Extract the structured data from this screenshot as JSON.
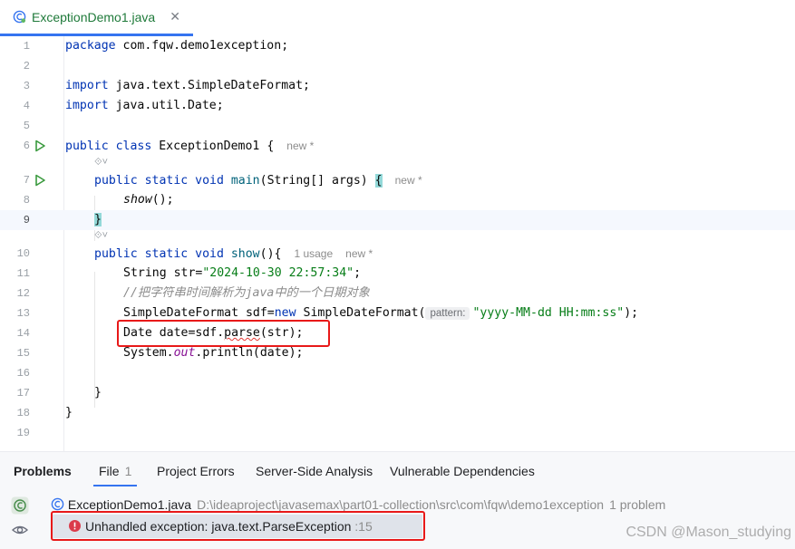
{
  "tab": {
    "title": "ExceptionDemo1.java",
    "close": "✕"
  },
  "editor": {
    "lines": [
      {
        "n": "1"
      },
      {
        "n": "2"
      },
      {
        "n": "3"
      },
      {
        "n": "4"
      },
      {
        "n": "5"
      },
      {
        "n": "6"
      },
      {
        "n": "7"
      },
      {
        "n": "8"
      },
      {
        "n": "9"
      },
      {
        "n": "10"
      },
      {
        "n": "11"
      },
      {
        "n": "12"
      },
      {
        "n": "13"
      },
      {
        "n": "14"
      },
      {
        "n": "15"
      },
      {
        "n": "16"
      },
      {
        "n": "17"
      },
      {
        "n": "18"
      },
      {
        "n": "19"
      }
    ],
    "code": {
      "l1_pkg_kw": "package",
      "l1_pkg": " com.fqw.demo1exception;",
      "l3_kw": "import",
      "l3_rest": " java.text.SimpleDateFormat;",
      "l4_kw": "import",
      "l4_rest": " java.util.Date;",
      "l6_kw": "public class",
      "l6_name": " ExceptionDemo1 {",
      "l6_hint": "new *",
      "l7_kw": "public static void",
      "l7_fn": " main",
      "l7_args": "(String[] args) ",
      "l7_brace": "{",
      "l7_hint": "new *",
      "l8_call": "show",
      "l8_rest": "();",
      "l9_brace": "}",
      "l10_kw": "public static void",
      "l10_fn": " show",
      "l10_rest": "(){",
      "l10_usage": "1 usage",
      "l10_hint": "new *",
      "l11_type": "String str=",
      "l11_str": "\"2024-10-30 22:57:34\"",
      "l11_end": ";",
      "l12_comment": "//把字符串时间解析为java中的一个日期对象",
      "l13_type": "SimpleDateFormat sdf=",
      "l13_kw": "new",
      "l13_ctor": " SimpleDateFormat(",
      "l13_param": "pattern:",
      "l13_str": "\"yyyy-MM-dd HH:mm:ss\"",
      "l13_end": ");",
      "l14_pre": "Date date=sdf.",
      "l14_call": "parse",
      "l14_end": "(str);",
      "l15_pre": "System.",
      "l15_static": "out",
      "l15_end": ".println(date);",
      "l17_brace": "}",
      "l18_brace": "}"
    },
    "inlay_marker": "⟐˅"
  },
  "problems": {
    "tabs": [
      {
        "label": "Problems"
      },
      {
        "label": "File",
        "count": "1"
      },
      {
        "label": "Project Errors"
      },
      {
        "label": "Server-Side Analysis"
      },
      {
        "label": "Vulnerable Dependencies"
      }
    ],
    "file_row": {
      "name": "ExceptionDemo1.java",
      "path": "D:\\ideaproject\\javasemax\\part01-collection\\src\\com\\fqw\\demo1exception",
      "count": "1 problem"
    },
    "error": {
      "message": "Unhandled exception: java.text.ParseException",
      "line": ":15"
    }
  },
  "watermark": "CSDN @Mason_studying",
  "colors": {
    "accent": "#3574f0",
    "error": "#e81919",
    "keyword": "#0033b3",
    "string": "#067d17"
  }
}
